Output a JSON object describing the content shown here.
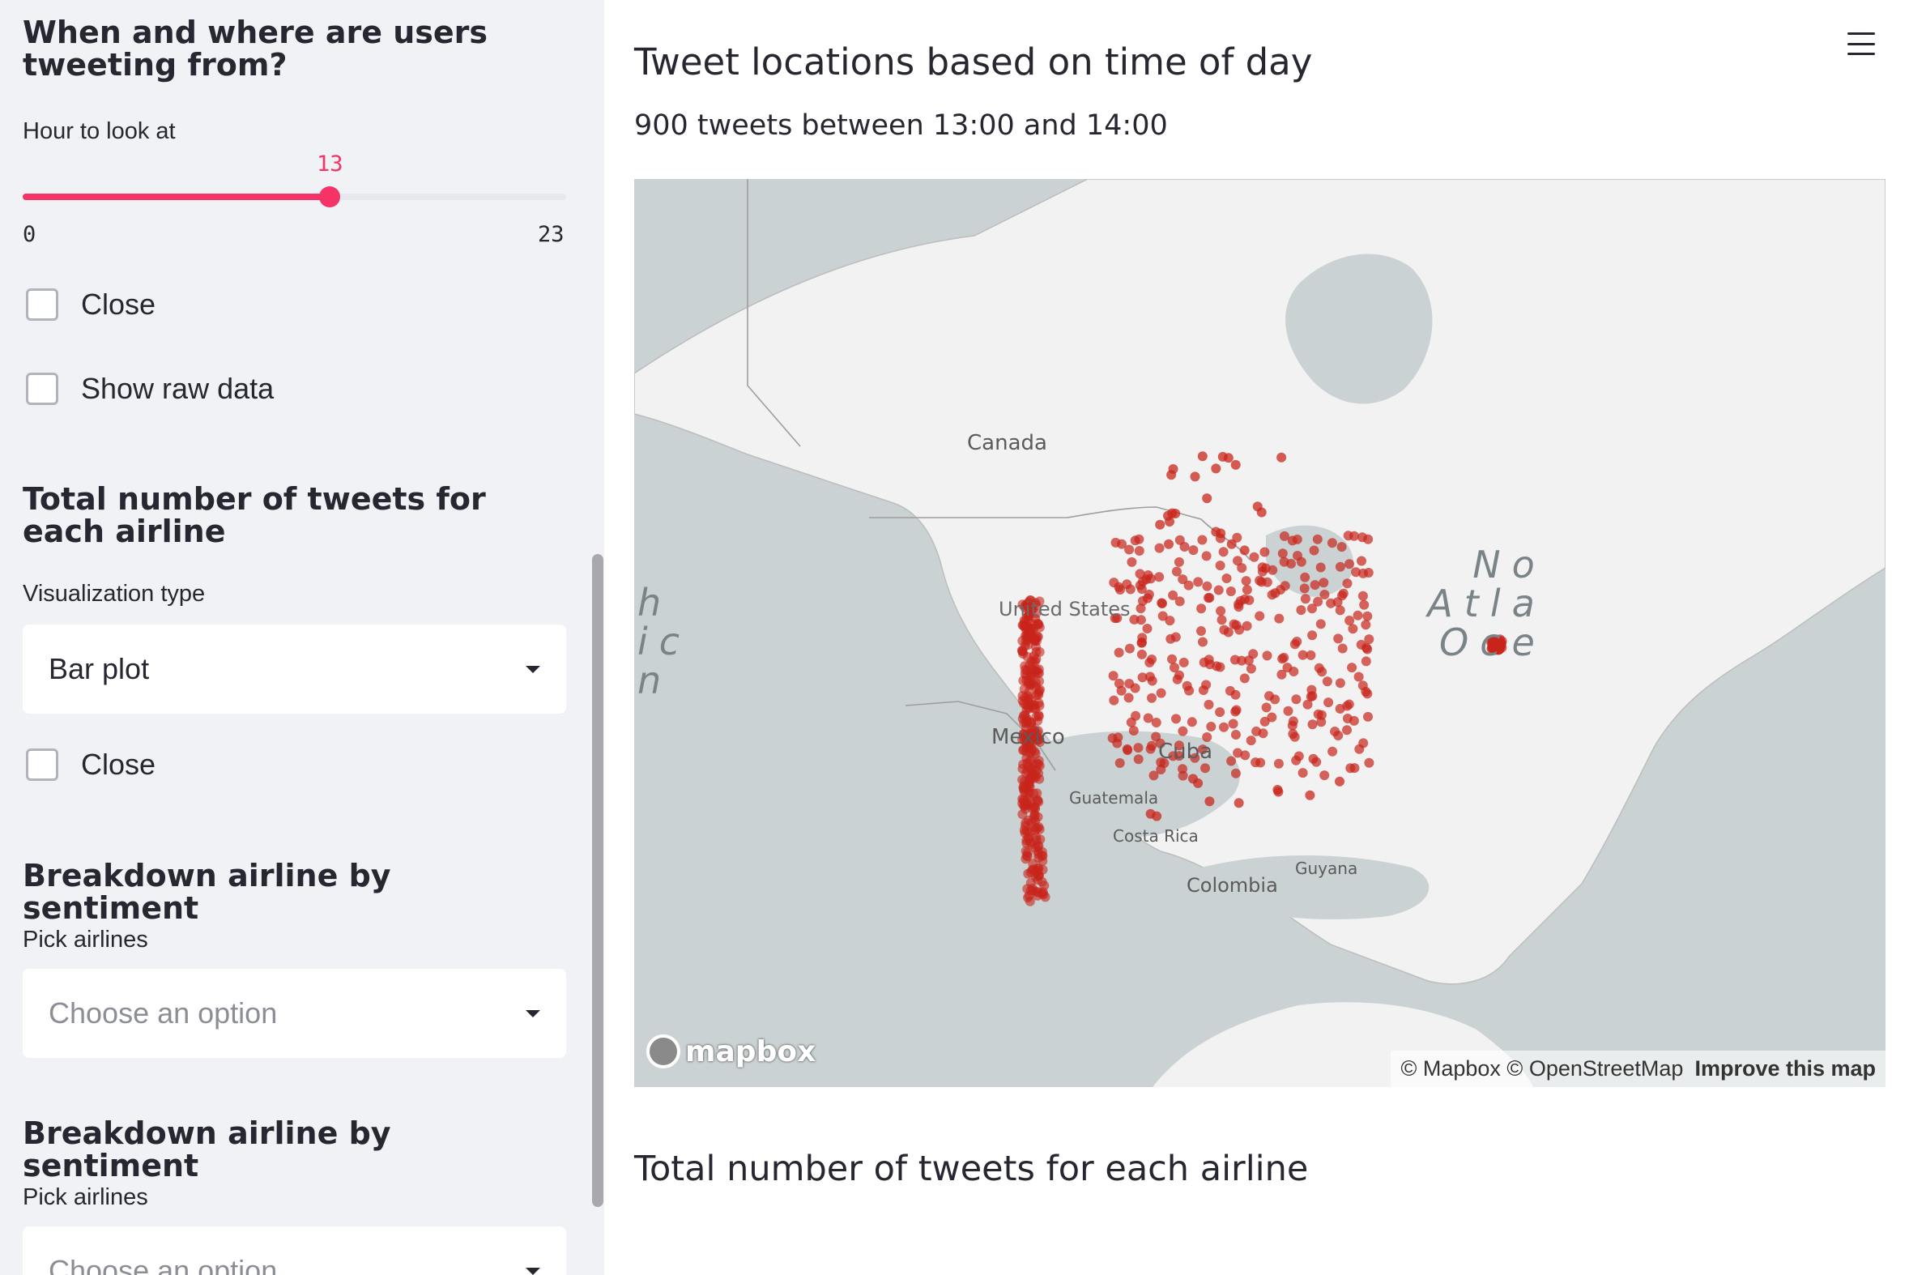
{
  "sidebar": {
    "heading_when_where": "When and where are users tweeting from?",
    "hour_slider": {
      "label": "Hour to look at",
      "value": 13,
      "min": 0,
      "max": 23
    },
    "close_checkbox_1": {
      "label": "Close",
      "checked": false
    },
    "raw_data_checkbox": {
      "label": "Show raw data",
      "checked": false
    },
    "heading_total": "Total number of tweets for each airline",
    "viz_type": {
      "label": "Visualization type",
      "value": "Bar plot"
    },
    "close_checkbox_2": {
      "label": "Close",
      "checked": false
    },
    "heading_breakdown_1": "Breakdown airline by sentiment",
    "pick_airlines_1": {
      "label": "Pick airlines",
      "placeholder": "Choose an option"
    },
    "heading_breakdown_2": "Breakdown airline by sentiment",
    "pick_airlines_2": {
      "label": "Pick airlines",
      "placeholder": "Choose an option"
    }
  },
  "main": {
    "title": "Tweet locations based on time of day",
    "subtitle": "900 tweets between 13:00 and 14:00",
    "section_heading": "Total number of tweets for each airline"
  },
  "map": {
    "labels": {
      "canada": "Canada",
      "united_states": "United States",
      "mexico": "Mexico",
      "cuba": "Cuba",
      "guatemala": "Guatemala",
      "costa_rica": "Costa Rica",
      "guyana": "Guyana",
      "colombia": "Colombia"
    },
    "ocean_left_fragments": [
      "h",
      "ic",
      "n"
    ],
    "ocean_right_fragments": [
      "No",
      "Atla",
      "Oce"
    ],
    "logo_text": "mapbox",
    "attribution": "© Mapbox © OpenStreetMap",
    "improve_link": "Improve this map",
    "point_color": "#c8251b"
  },
  "colors": {
    "accent": "#f63366",
    "sidebar_bg": "#f0f2f6",
    "text": "#262730"
  },
  "icons": {
    "menu": "hamburger-menu-icon",
    "dropdown": "caret-down-icon"
  }
}
